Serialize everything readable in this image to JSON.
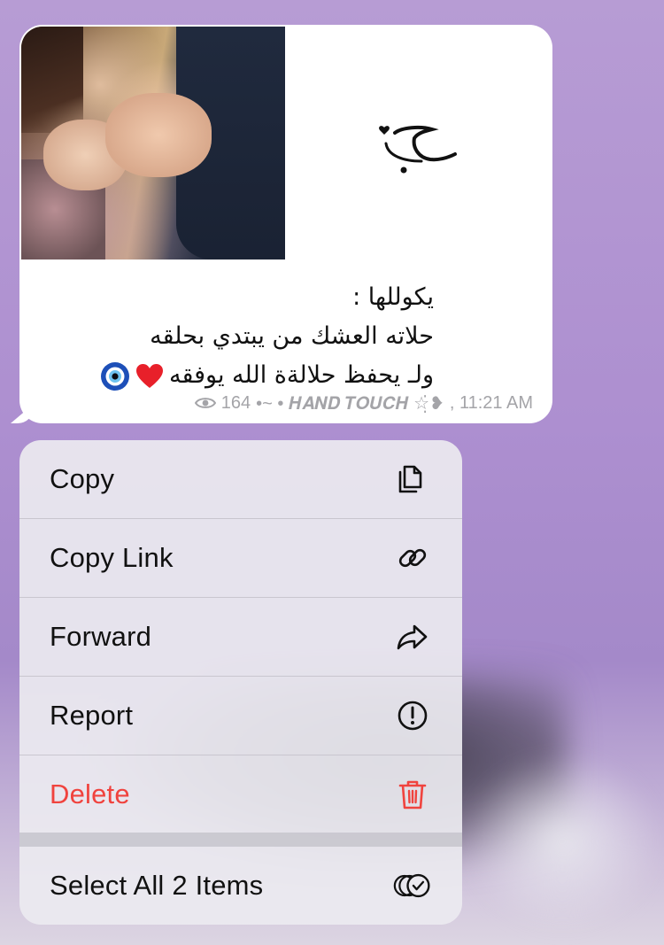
{
  "message": {
    "caption_lines": [
      "يكوللها :",
      "حلاته العشك من يبتدي بحلقه",
      "ولـ يحفظ حلالةة الله يوفقه"
    ],
    "emoji_heart": "❤️",
    "emoji_eye": "🧿",
    "views": "164",
    "author_signature": "•~ • 𝑯𝑨𝑵𝑫 𝑻𝑶𝑼𝑪𝑯 ☆̣̇❥",
    "time": ", 11:21 AM",
    "sticker_text": "حب"
  },
  "menu": {
    "items": [
      {
        "label": "Copy",
        "icon": "copy-icon"
      },
      {
        "label": "Copy Link",
        "icon": "link-icon"
      },
      {
        "label": "Forward",
        "icon": "forward-icon"
      },
      {
        "label": "Report",
        "icon": "report-icon"
      },
      {
        "label": "Delete",
        "icon": "trash-icon"
      },
      {
        "label": "Select All 2 Items",
        "icon": "select-all-icon"
      }
    ]
  },
  "colors": {
    "delete": "#f0433e",
    "meta_text": "#a4a4a8",
    "background": "#ad8fd0"
  }
}
